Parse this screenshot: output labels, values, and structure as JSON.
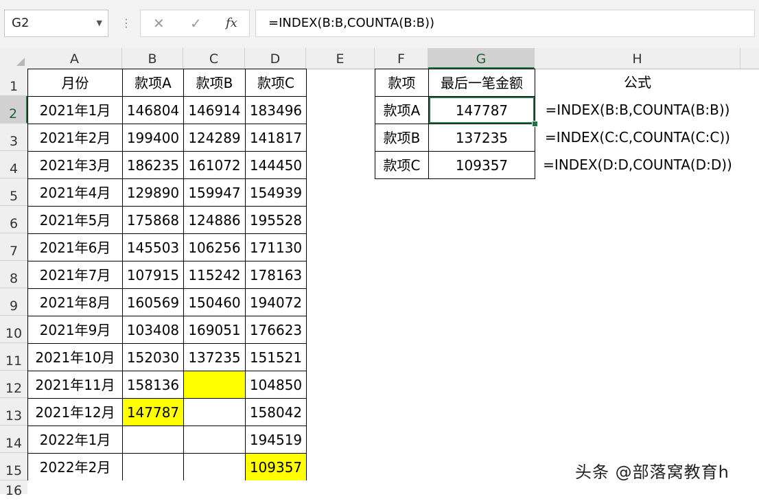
{
  "namebox": {
    "value": "G2"
  },
  "formula_bar": {
    "cancel_symbol": "✕",
    "enter_symbol": "✓",
    "fx_symbol": "fx",
    "value": "=INDEX(B:B,COUNTA(B:B))"
  },
  "columns": [
    "A",
    "B",
    "C",
    "D",
    "E",
    "F",
    "G",
    "H"
  ],
  "rows": [
    "1",
    "2",
    "3",
    "4",
    "5",
    "6",
    "7",
    "8",
    "9",
    "10",
    "11",
    "12",
    "13",
    "14",
    "15",
    "16"
  ],
  "main_table": {
    "headers": [
      "月份",
      "款项A",
      "款项B",
      "款项C"
    ],
    "rows": [
      [
        "2021年1月",
        "146804",
        "146914",
        "183496"
      ],
      [
        "2021年2月",
        "199400",
        "124289",
        "141817"
      ],
      [
        "2021年3月",
        "186235",
        "161072",
        "144450"
      ],
      [
        "2021年4月",
        "129890",
        "159947",
        "154939"
      ],
      [
        "2021年5月",
        "175868",
        "124886",
        "195528"
      ],
      [
        "2021年6月",
        "145503",
        "106256",
        "171130"
      ],
      [
        "2021年7月",
        "107915",
        "115242",
        "178163"
      ],
      [
        "2021年8月",
        "160569",
        "150460",
        "194072"
      ],
      [
        "2021年9月",
        "103408",
        "169051",
        "176623"
      ],
      [
        "2021年10月",
        "152030",
        "137235",
        "151521"
      ],
      [
        "2021年11月",
        "158136",
        "",
        "104850"
      ],
      [
        "2021年12月",
        "147787",
        "",
        "158042"
      ],
      [
        "2022年1月",
        "",
        "",
        "194519"
      ],
      [
        "2022年2月",
        "",
        "",
        "109357"
      ]
    ]
  },
  "lookup_table": {
    "headers": [
      "款项",
      "最后一笔金额",
      "公式"
    ],
    "rows": [
      [
        "款项A",
        "147787",
        "=INDEX(B:B,COUNTA(B:B))"
      ],
      [
        "款项B",
        "137235",
        "=INDEX(C:C,COUNTA(C:C))"
      ],
      [
        "款项C",
        "109357",
        "=INDEX(D:D,COUNTA(D:D))"
      ]
    ]
  },
  "highlight_color": "#ffff00",
  "selection_color": "#217346",
  "watermark": "头条 @部落窝教育h"
}
